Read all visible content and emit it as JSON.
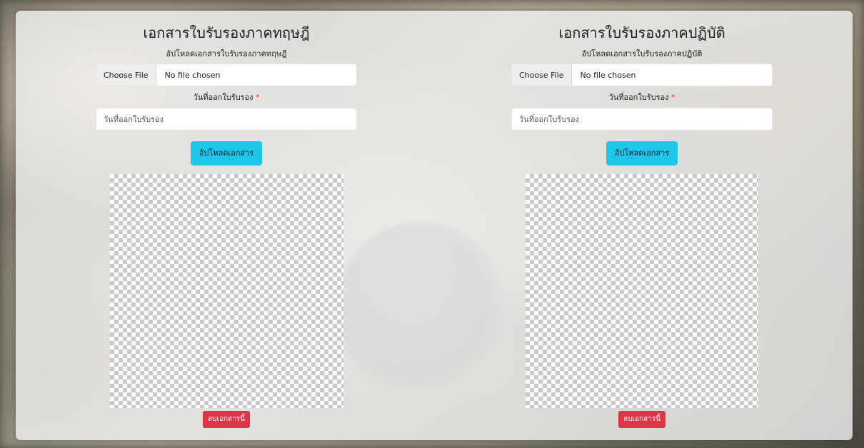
{
  "theme": {
    "upload_color": "#1ec7ea",
    "delete_color": "#dc3545",
    "required_color": "#dc3545"
  },
  "theory": {
    "title": "เอกสารใบรับรองภาคทฤษฎี",
    "upload_label": "อัปโหลดเอกสารใบรับรองภาคทฤษฎี",
    "choose_file_label": "Choose File",
    "file_status": "No file chosen",
    "date_label": "วันที่ออกใบรับรอง",
    "required_mark": "*",
    "date_placeholder": "วันที่ออกใบรับรอง",
    "upload_button": "อัปโหลดเอกสาร",
    "delete_button": "ลบเอกสารนี้"
  },
  "practice": {
    "title": "เอกสารใบรับรองภาคปฏิบัติ",
    "upload_label": "อัปโหลดเอกสารใบรับรองภาคปฏิบัติ",
    "choose_file_label": "Choose File",
    "file_status": "No file chosen",
    "date_label": "วันที่ออกใบรับรอง",
    "required_mark": "*",
    "date_placeholder": "วันที่ออกใบรับรอง",
    "upload_button": "อัปโหลดเอกสาร",
    "delete_button": "ลบเอกสารนี้"
  }
}
